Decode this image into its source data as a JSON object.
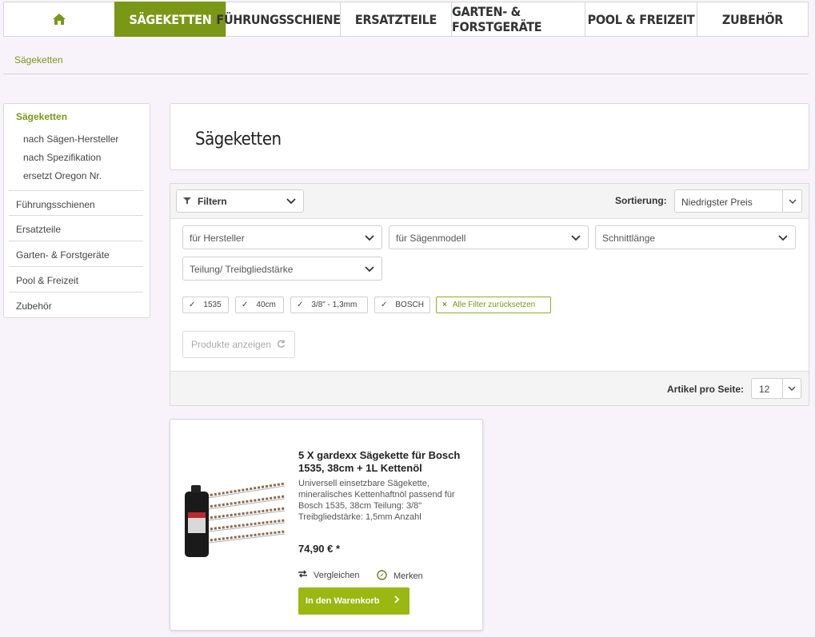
{
  "nav": {
    "home_icon": "home-icon",
    "items": [
      {
        "label": "SÄGEKETTEN",
        "active": true
      },
      {
        "label": "FÜHRUNGSSCHIENEN"
      },
      {
        "label": "ERSATZTEILE"
      },
      {
        "label": "GARTEN- & FORSTGERÄTE"
      },
      {
        "label": "POOL & FREIZEIT"
      },
      {
        "label": "ZUBEHÖR"
      }
    ]
  },
  "breadcrumb": "Sägeketten",
  "sidebar": {
    "active_category": "Sägeketten",
    "subitems": [
      "nach Sägen-Hersteller",
      "nach Spezifikation",
      "ersetzt Oregon Nr."
    ],
    "items": [
      "Führungsschienen",
      "Ersatzteile",
      "Garten- & Forstgeräte",
      "Pool & Freizeit",
      "Zubehör"
    ]
  },
  "page_title": "Sägeketten",
  "filter": {
    "button_label": "Filtern",
    "sort_label": "Sortierung:",
    "sort_value": "Niedrigster Preis",
    "dropdowns": [
      "für Hersteller",
      "für Sägenmodell",
      "Schnittlänge",
      "Teilung/ Treibgliedstärke"
    ],
    "active_tags": [
      "1535",
      "40cm",
      "3/8\" - 1,3mm",
      "BOSCH"
    ],
    "reset_label": "Alle Filter zurücksetzen",
    "show_button": "Produkte anzeigen",
    "per_page_label": "Artikel pro Seite:",
    "per_page_value": "12"
  },
  "product": {
    "title": "5 X gardexx Sägekette für Bosch 1535, 38cm + 1L Kettenöl",
    "description": "Universell einsetzbare Sägekette, mineralisches Kettenhaftnöl passend für Bosch 1535, 38cm Teilung: 3/8\" Treibgliedstärke: 1,5mm Anzahl",
    "price": "74,90 € *",
    "compare_label": "Vergleichen",
    "wishlist_label": "Merken",
    "cart_label": "In den Warenkorb"
  },
  "colors": {
    "accent": "#7b9716",
    "cart_button": "#9ab811",
    "background": "#f8f3fb"
  }
}
